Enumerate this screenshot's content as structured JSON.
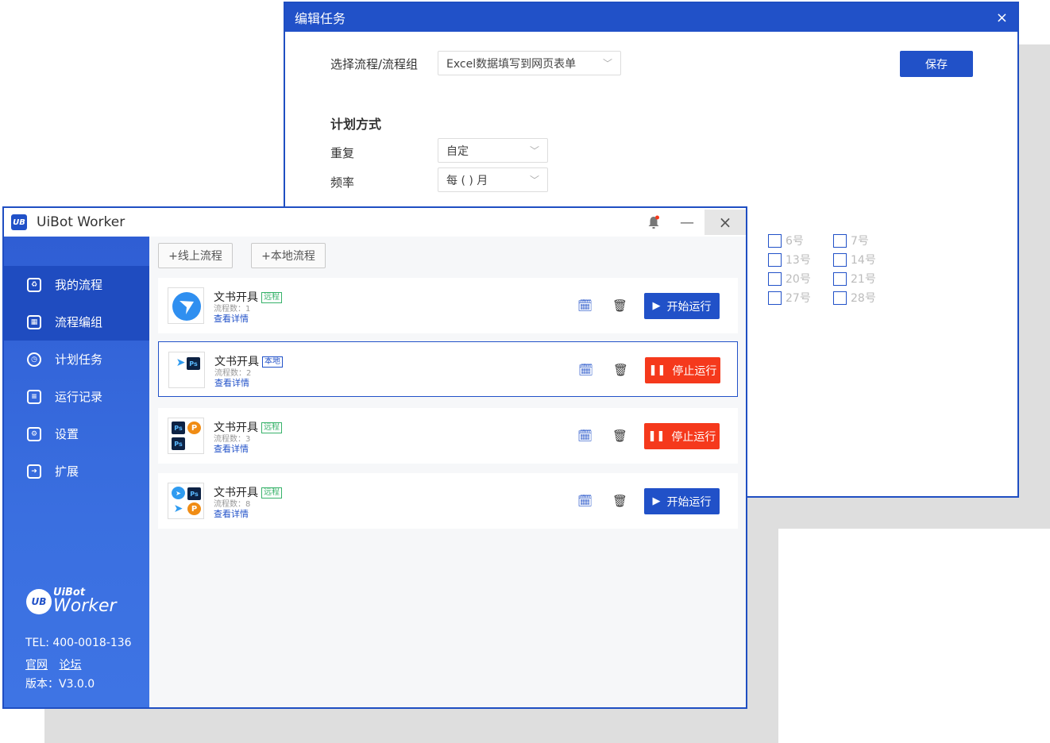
{
  "colors": {
    "brand": "#2151c8",
    "stop": "#f5391c",
    "remote_tag": "#37b26a"
  },
  "dialog": {
    "title": "编辑任务",
    "close_icon": "×",
    "select_process_label": "选择流程/流程组",
    "select_process_value": "Excel数据填写到网页表单",
    "save_label": "保存",
    "plan_heading": "计划方式",
    "repeat_label": "重复",
    "repeat_value": "自定",
    "frequency_label": "频率",
    "frequency_value": "每 ( ) 月",
    "days": [
      "6号",
      "7号",
      "13号",
      "14号",
      "20号",
      "21号",
      "27号",
      "28号"
    ]
  },
  "window": {
    "title": "UiBot Worker",
    "logo_text": "UB",
    "minimize_icon": "—",
    "close_icon": "×"
  },
  "sidebar": {
    "items": [
      {
        "label": "我的流程",
        "icon": "recycle-icon",
        "active": true
      },
      {
        "label": "流程编组",
        "icon": "group-icon",
        "active": false
      },
      {
        "label": "计划任务",
        "icon": "clock-icon",
        "active": false
      },
      {
        "label": "运行记录",
        "icon": "list-icon",
        "active": false
      },
      {
        "label": "设置",
        "icon": "settings-icon",
        "active": false
      },
      {
        "label": "扩展",
        "icon": "extension-icon",
        "active": false
      }
    ],
    "brand_top": "UiBot",
    "brand_bottom": "Worker",
    "tel": "TEL: 400-0018-136",
    "link_site": "官网",
    "link_forum": "论坛",
    "version": "版本：V3.0.0"
  },
  "toolbar": {
    "online_label": "+线上流程",
    "local_label": "+本地流程"
  },
  "processes": [
    {
      "name": "文书开具",
      "tag": "远程",
      "count": "流程数：1",
      "link": "查看详情",
      "action": "开始运行",
      "state": "start"
    },
    {
      "name": "文书开具",
      "tag": "本地",
      "count": "流程数：2",
      "link": "查看详情",
      "action": "停止运行",
      "state": "stop"
    },
    {
      "name": "文书开具",
      "tag": "远程",
      "count": "流程数：3",
      "link": "查看详情",
      "action": "停止运行",
      "state": "stop"
    },
    {
      "name": "文书开具",
      "tag": "远程",
      "count": "流程数：8",
      "link": "查看详情",
      "action": "开始运行",
      "state": "start"
    }
  ]
}
